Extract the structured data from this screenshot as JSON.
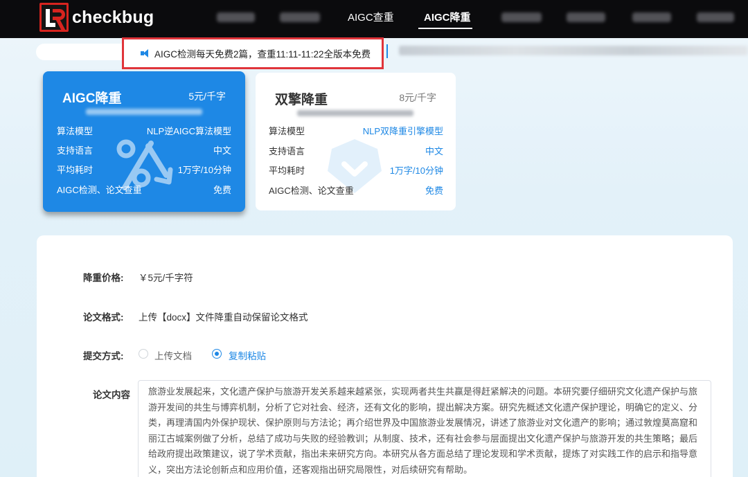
{
  "nav": {
    "logo_text": "checkbug",
    "items": [
      {
        "label": "AIGC查重",
        "active": false
      },
      {
        "label": "AIGC降重",
        "active": true
      }
    ]
  },
  "announcement": {
    "text": "AIGC检测每天免费2篇，查重11:11-11:22全版本免费",
    "icon": "speaker-icon"
  },
  "plans": [
    {
      "title": "AIGC降重",
      "price": "5元/千字",
      "selected": true,
      "rows": [
        {
          "label": "算法模型",
          "value": "NLP逆AIGC算法模型"
        },
        {
          "label": "支持语言",
          "value": "中文"
        },
        {
          "label": "平均耗时",
          "value": "1万字/10分钟"
        },
        {
          "label": "AIGC检测、论文查重",
          "value": "免费"
        }
      ]
    },
    {
      "title": "双擎降重",
      "price": "8元/千字",
      "selected": false,
      "rows": [
        {
          "label": "算法模型",
          "value": "NLP双降重引擎模型"
        },
        {
          "label": "支持语言",
          "value": "中文"
        },
        {
          "label": "平均耗时",
          "value": "1万字/10分钟"
        },
        {
          "label": "AIGC检测、论文查重",
          "value": "免费"
        }
      ]
    }
  ],
  "form": {
    "price_label": "降重价格:",
    "price_value": "￥5元/千字符",
    "format_label": "论文格式:",
    "format_value": "上传【docx】文件降重自动保留论文格式",
    "submit_label": "提交方式:",
    "submit_options": [
      {
        "label": "上传文档",
        "selected": false
      },
      {
        "label": "复制粘贴",
        "selected": true
      }
    ],
    "content_label": "论文内容",
    "content_text": "旅游业发展起来，文化遗产保护与旅游开发关系越来越紧张，实现两者共生共赢是得赶紧解决的问题。本研究要仔细研究文化遗产保护与旅游开发间的共生与博弈机制，分析了它对社会、经济，还有文化的影响，提出解决方案。研究先概述文化遗产保护理论，明确它的定义、分类，再理清国内外保护现状、保护原则与方法论；再介绍世界及中国旅游业发展情况，讲述了旅游业对文化遗产的影响；通过敦煌莫高窟和丽江古城案例做了分析，总结了成功与失败的经验教训；从制度、技术，还有社会参与层面提出文化遗产保护与旅游开发的共生策略；最后给政府提出政策建议，说了学术贡献，指出未来研究方向。本研究从各方面总结了理论发现和学术贡献，提炼了对实践工作的启示和指导意义，突出方法论创新点和应用价值，还客观指出研究局限性，对后续研究有帮助。"
  },
  "colors": {
    "accent": "#1e88e5",
    "nav_bg": "#0b0b0d",
    "highlight_border": "#e0343a",
    "logo_red": "#d8241f"
  }
}
